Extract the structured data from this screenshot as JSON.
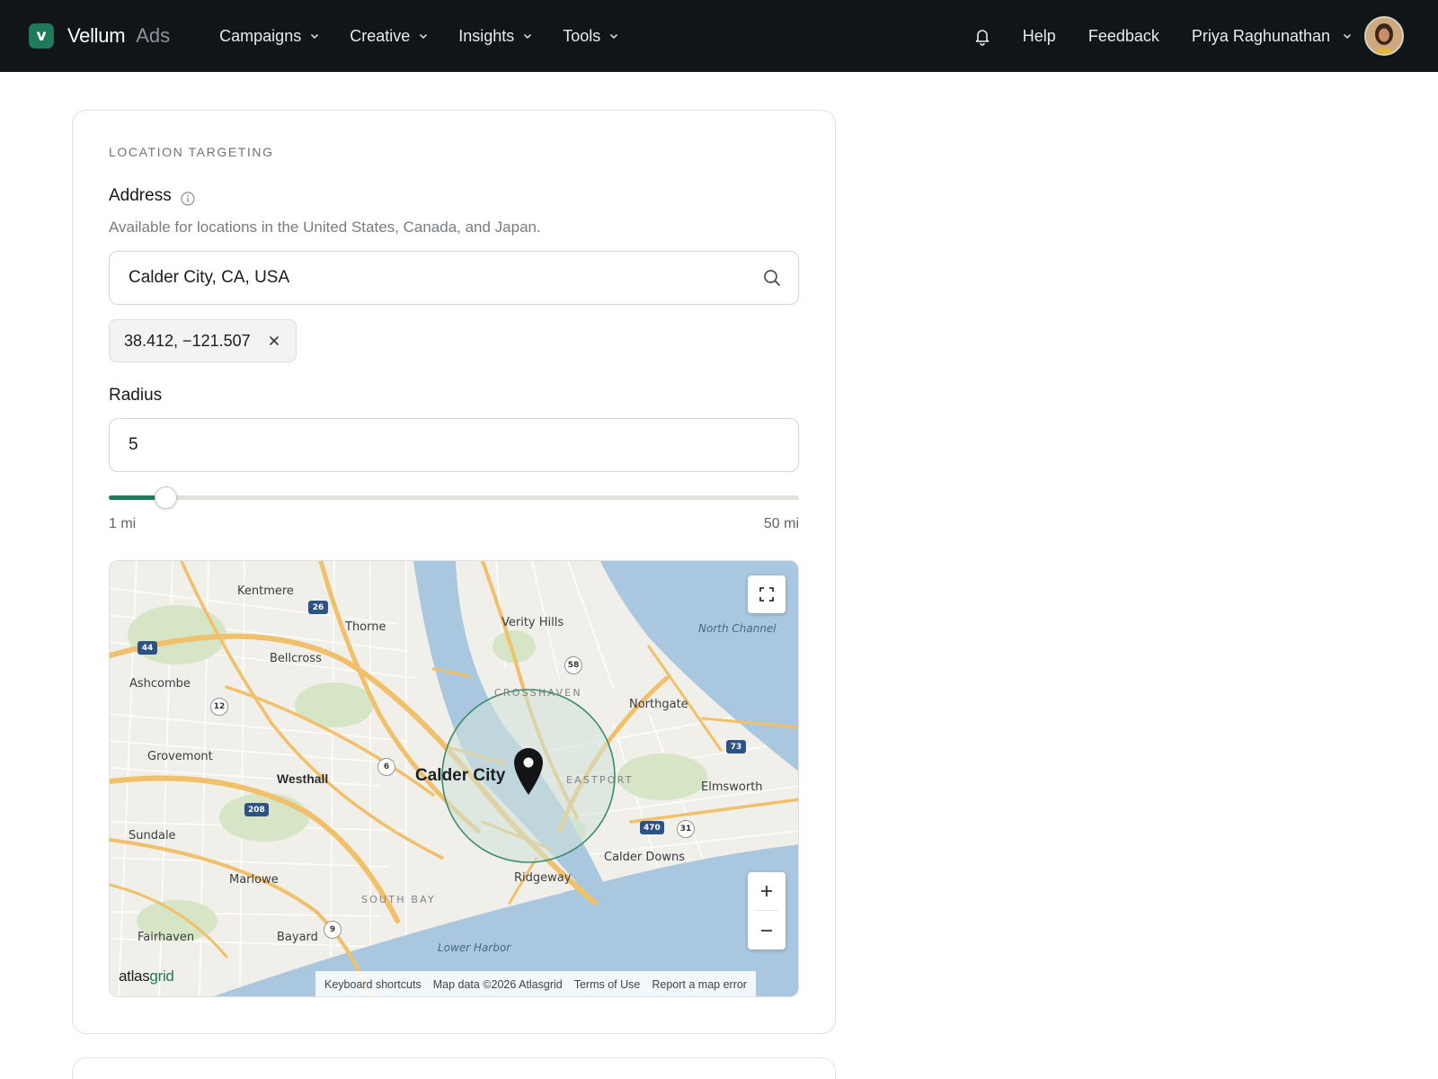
{
  "nav": {
    "brand_name": "Vellum",
    "brand_sub": "Ads",
    "brand_letter": "v",
    "menu": [
      {
        "label": "Campaigns",
        "icon": "chevron-down-icon"
      },
      {
        "label": "Creative",
        "icon": "chevron-down-icon"
      },
      {
        "label": "Insights",
        "icon": "chevron-down-icon"
      },
      {
        "label": "Tools",
        "icon": "chevron-down-icon"
      }
    ],
    "bell_icon": "bell-icon",
    "help_label": "Help",
    "feedback_label": "Feedback",
    "user_name": "Priya Raghunathan"
  },
  "location": {
    "section_title": "LOCATION TARGETING",
    "address_label": "Address",
    "address_helper": "Available for locations in the United States, Canada, and Japan.",
    "address_value": "Calder City, CA, USA",
    "coords_chip": "38.412, −121.507",
    "radius_label": "Radius",
    "radius_value": "5",
    "slider": {
      "min_label": "1 mi",
      "max_label": "50 mi",
      "min": 1,
      "max": 50,
      "value": 5
    }
  },
  "map": {
    "places": {
      "kentmere": "Kentmere",
      "thorne": "Thorne",
      "verity_hills": "Verity Hills",
      "bellcross": "Bellcross",
      "ashcombe": "Ashcombe",
      "northgate": "Northgate",
      "grovemont": "Grovemont",
      "westhall": "Westhall",
      "calder_city": "Calder City",
      "elmsworth": "Elmsworth",
      "sundale": "Sundale",
      "calder_downs": "Calder Downs",
      "ridgeway": "Ridgeway",
      "marlowe": "Marlowe",
      "fairhaven": "Fairhaven",
      "bayard": "Bayard"
    },
    "districts": {
      "crosshaven": "CROSSHAVEN",
      "eastport": "EASTPORT",
      "south_bay": "SOUTH BAY"
    },
    "water": {
      "north_channel": "North Channel",
      "lower_harbor": "Lower Harbor"
    },
    "shields": {
      "s26": "26",
      "s44": "44",
      "s73": "73",
      "s208": "208",
      "s470": "470"
    },
    "roundels": {
      "r58": "58",
      "r12": "12",
      "r6": "6",
      "r31": "31",
      "r9": "9"
    },
    "attribution": {
      "logo_a": "atlas",
      "logo_b": "grid",
      "items": [
        "Keyboard shortcuts",
        "Map data ©2026 Atlasgrid",
        "Terms of Use",
        "Report a map error"
      ]
    },
    "colors": {
      "water": "#a9c8e0",
      "land": "#f1efe9",
      "park": "#d8e6c7",
      "highway": "#f3c46a",
      "radius": "#3b8c6d"
    }
  }
}
